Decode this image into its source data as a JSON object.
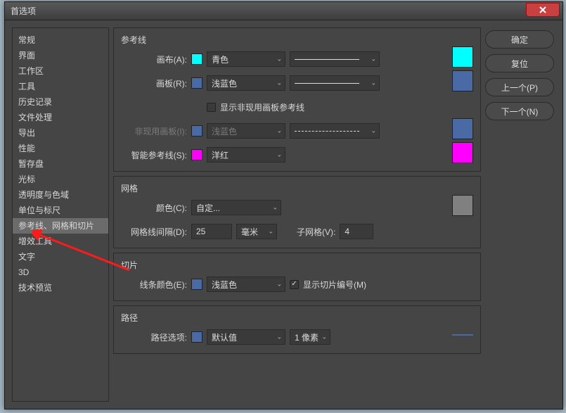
{
  "title": "首选项",
  "sidebar": {
    "items": [
      {
        "label": "常规"
      },
      {
        "label": "界面"
      },
      {
        "label": "工作区"
      },
      {
        "label": "工具"
      },
      {
        "label": "历史记录"
      },
      {
        "label": "文件处理"
      },
      {
        "label": "导出"
      },
      {
        "label": "性能"
      },
      {
        "label": "暂存盘"
      },
      {
        "label": "光标"
      },
      {
        "label": "透明度与色域"
      },
      {
        "label": "单位与标尺"
      },
      {
        "label": "参考线、网格和切片"
      },
      {
        "label": "增效工具"
      },
      {
        "label": "文字"
      },
      {
        "label": "3D"
      },
      {
        "label": "技术预览"
      }
    ],
    "selected_index": 12
  },
  "guides": {
    "legend": "参考线",
    "canvas_label": "画布(A):",
    "canvas_color_name": "青色",
    "canvas_swatch": "#00ffff",
    "artboard_label": "画板(R):",
    "artboard_color_name": "浅蓝色",
    "artboard_swatch": "#4a6aa5",
    "show_inactive_label": "显示非现用画板参考线",
    "show_inactive_checked": false,
    "inactive_label": "非现用画板(I):",
    "inactive_color_name": "浅蓝色",
    "inactive_swatch": "#4a6aa5",
    "smart_label": "智能参考线(S):",
    "smart_color_name": "洋红",
    "smart_swatch": "#ff00ff"
  },
  "grid": {
    "legend": "网格",
    "color_label": "颜色(C):",
    "color_name": "自定...",
    "swatch": "#808080",
    "spacing_label": "网格线间隔(D):",
    "spacing_value": "25",
    "spacing_unit": "毫米",
    "subgrid_label": "子网格(V):",
    "subgrid_value": "4"
  },
  "slices": {
    "legend": "切片",
    "color_label": "线条颜色(E):",
    "color_name": "浅蓝色",
    "color_hex": "#4a6aa5",
    "show_numbers_label": "显示切片编号(M)",
    "show_numbers_checked": true
  },
  "paths": {
    "legend": "路径",
    "options_label": "路径选项:",
    "color_name": "默认值",
    "color_hex": "#4a6aa5",
    "width": "1 像素"
  },
  "buttons": {
    "ok": "确定",
    "reset": "复位",
    "prev": "上一个(P)",
    "next": "下一个(N)"
  }
}
